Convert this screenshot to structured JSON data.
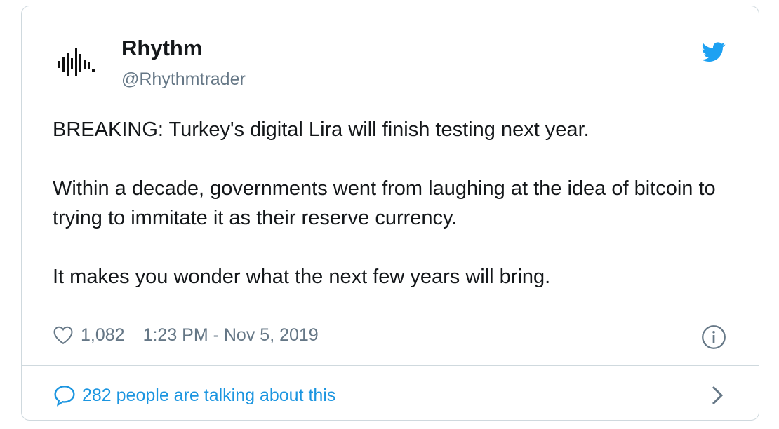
{
  "tweet": {
    "author_name": "Rhythm",
    "author_handle": "@Rhythmtrader",
    "paragraphs": [
      "BREAKING: Turkey's digital Lira will finish testing next year.",
      "Within a decade, governments went from laughing at the idea of bitcoin to trying to immitate it as their reserve currency.",
      "It makes you wonder what the next few years will bring."
    ],
    "like_count": "1,082",
    "timestamp": "1:23 PM - Nov 5, 2019",
    "conversation_label": "282 people are talking about this"
  },
  "icons": {
    "avatar": "waveform-logo-icon",
    "brand": "twitter-bird-icon",
    "like": "heart-icon",
    "info": "info-icon",
    "reply": "speech-bubble-icon",
    "more": "chevron-right-icon"
  },
  "colors": {
    "accent": "#1da1f2",
    "link": "#1b95e0",
    "text": "#14171a",
    "muted": "#657786",
    "border": "#cfd9de"
  }
}
